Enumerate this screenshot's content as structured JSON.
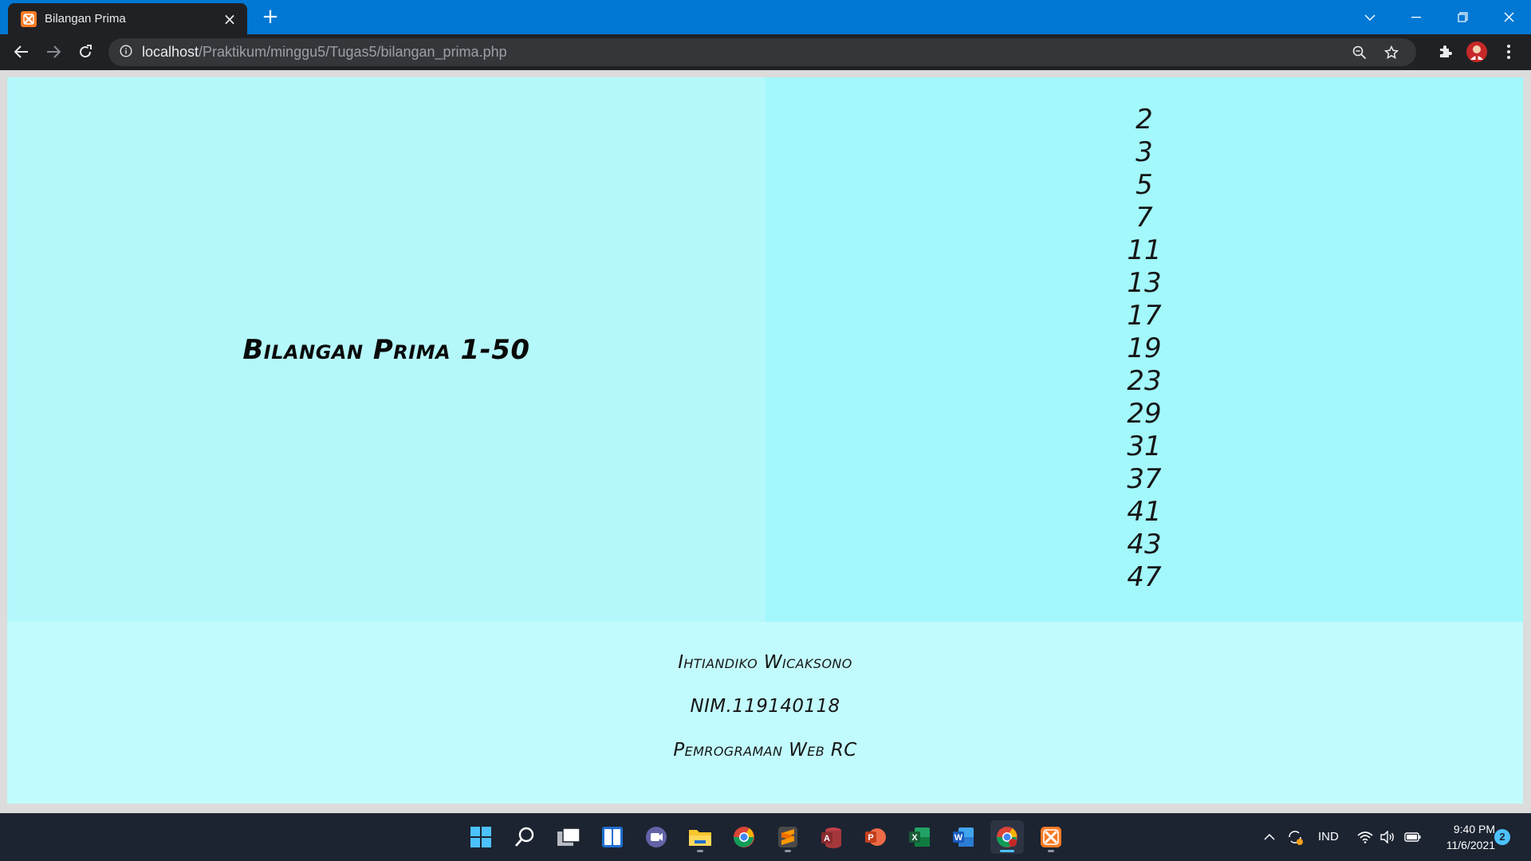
{
  "browser": {
    "tab_title": "Bilangan Prima",
    "url_host": "localhost",
    "url_path": "/Praktikum/minggu5/Tugas5/bilangan_prima.php"
  },
  "page": {
    "heading": "Bilangan Prima 1-50",
    "primes": [
      "2",
      "3",
      "5",
      "7",
      "11",
      "13",
      "17",
      "19",
      "23",
      "29",
      "31",
      "37",
      "41",
      "43",
      "47"
    ],
    "footer": {
      "name": "Ihtiandiko Wicaksono",
      "nim": "NIM.119140118",
      "course": "Pemrograman Web RC"
    }
  },
  "taskbar": {
    "apps": [
      "start-icon",
      "search-icon",
      "task-view-icon",
      "widgets-icon",
      "teams-chat-icon",
      "file-explorer-icon",
      "chrome-icon",
      "sublime-text-icon",
      "access-icon",
      "powerpoint-icon",
      "excel-icon",
      "word-icon",
      "chrome-active-icon",
      "xampp-icon"
    ],
    "language": "IND",
    "time": "9:40 PM",
    "date": "11/6/2021",
    "notification_count": "2"
  },
  "colors": {
    "tab_bar": "#0078d4",
    "toolbar": "#202124",
    "left_panel": "#b5f8fc",
    "right_panel": "#a3f8fb",
    "footer": "#c2fbfd",
    "taskbar": "#1c2431"
  }
}
